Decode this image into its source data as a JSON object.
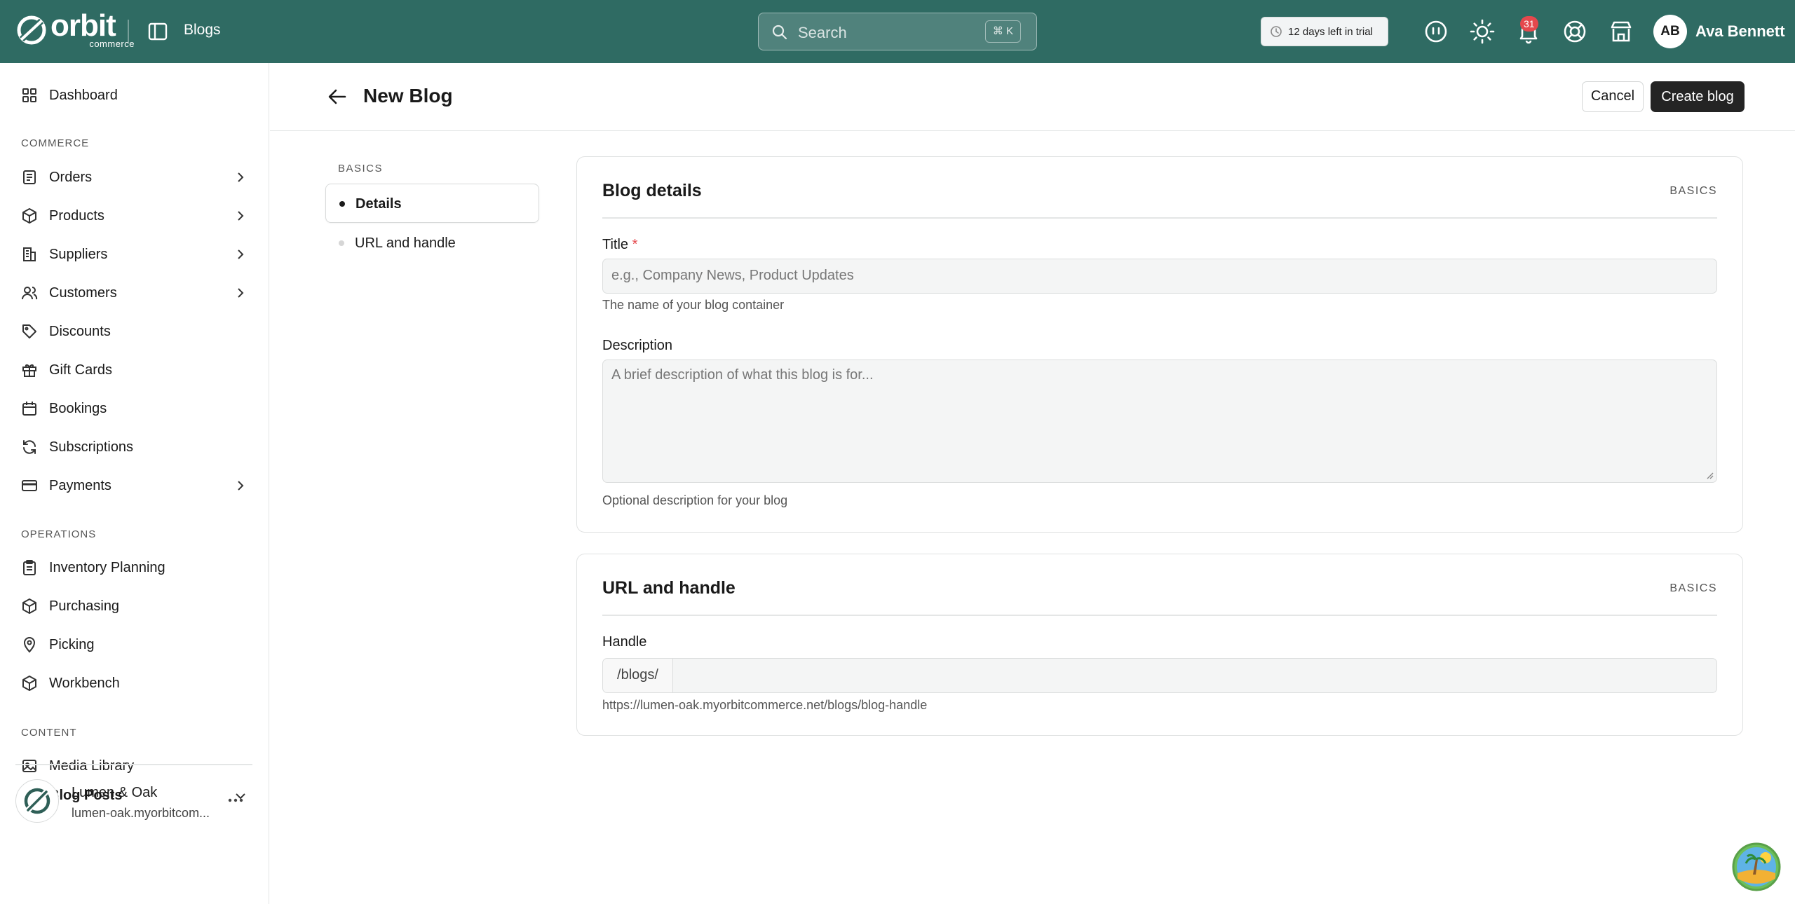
{
  "topbar": {
    "logo_word": "orbit",
    "logo_sub": "commerce",
    "crumb": "Blogs",
    "search_placeholder": "Search",
    "search_shortcut": "⌘ K",
    "trial_text": "12 days left in trial",
    "notification_count": "31",
    "avatar_initials": "AB",
    "user_name": "Ava Bennett"
  },
  "sidebar": {
    "dashboard": "Dashboard",
    "commerce_label": "COMMERCE",
    "commerce_items": [
      {
        "label": "Orders",
        "icon": "orders-icon",
        "chevron": true
      },
      {
        "label": "Products",
        "icon": "box-icon",
        "chevron": true
      },
      {
        "label": "Suppliers",
        "icon": "building-icon",
        "chevron": true
      },
      {
        "label": "Customers",
        "icon": "users-icon",
        "chevron": true
      },
      {
        "label": "Discounts",
        "icon": "tag-icon",
        "chevron": false
      },
      {
        "label": "Gift Cards",
        "icon": "gift-icon",
        "chevron": false
      },
      {
        "label": "Bookings",
        "icon": "calendar-icon",
        "chevron": false
      },
      {
        "label": "Subscriptions",
        "icon": "refresh-icon",
        "chevron": false
      },
      {
        "label": "Payments",
        "icon": "card-icon",
        "chevron": true
      }
    ],
    "operations_label": "OPERATIONS",
    "operations_items": [
      {
        "label": "Inventory Planning",
        "icon": "clipboard-icon"
      },
      {
        "label": "Purchasing",
        "icon": "box-icon"
      },
      {
        "label": "Picking",
        "icon": "pin-icon"
      },
      {
        "label": "Workbench",
        "icon": "box-icon"
      }
    ],
    "content_label": "CONTENT",
    "content_items": [
      {
        "label": "Media Library",
        "icon": "image-icon"
      },
      {
        "label": "Blog Posts",
        "icon": "blog-icon"
      }
    ],
    "store_name": "Lumen & Oak",
    "store_url": "lumen-oak.myorbitcom..."
  },
  "header": {
    "title": "New Blog",
    "cancel": "Cancel",
    "create": "Create blog"
  },
  "toc": {
    "section": "BASICS",
    "items": [
      "Details",
      "URL and handle"
    ]
  },
  "details_card": {
    "title": "Blog details",
    "tag": "BASICS",
    "title_label": "Title",
    "title_required": "*",
    "title_placeholder": "e.g., Company News, Product Updates",
    "title_help": "The name of your blog container",
    "desc_label": "Description",
    "desc_placeholder": "A brief description of what this blog is for...",
    "desc_help": "Optional description for your blog"
  },
  "url_card": {
    "title": "URL and handle",
    "tag": "BASICS",
    "handle_label": "Handle",
    "handle_prefix": "/blogs/",
    "handle_help": "https://lumen-oak.myorbitcommerce.net/blogs/blog-handle"
  }
}
